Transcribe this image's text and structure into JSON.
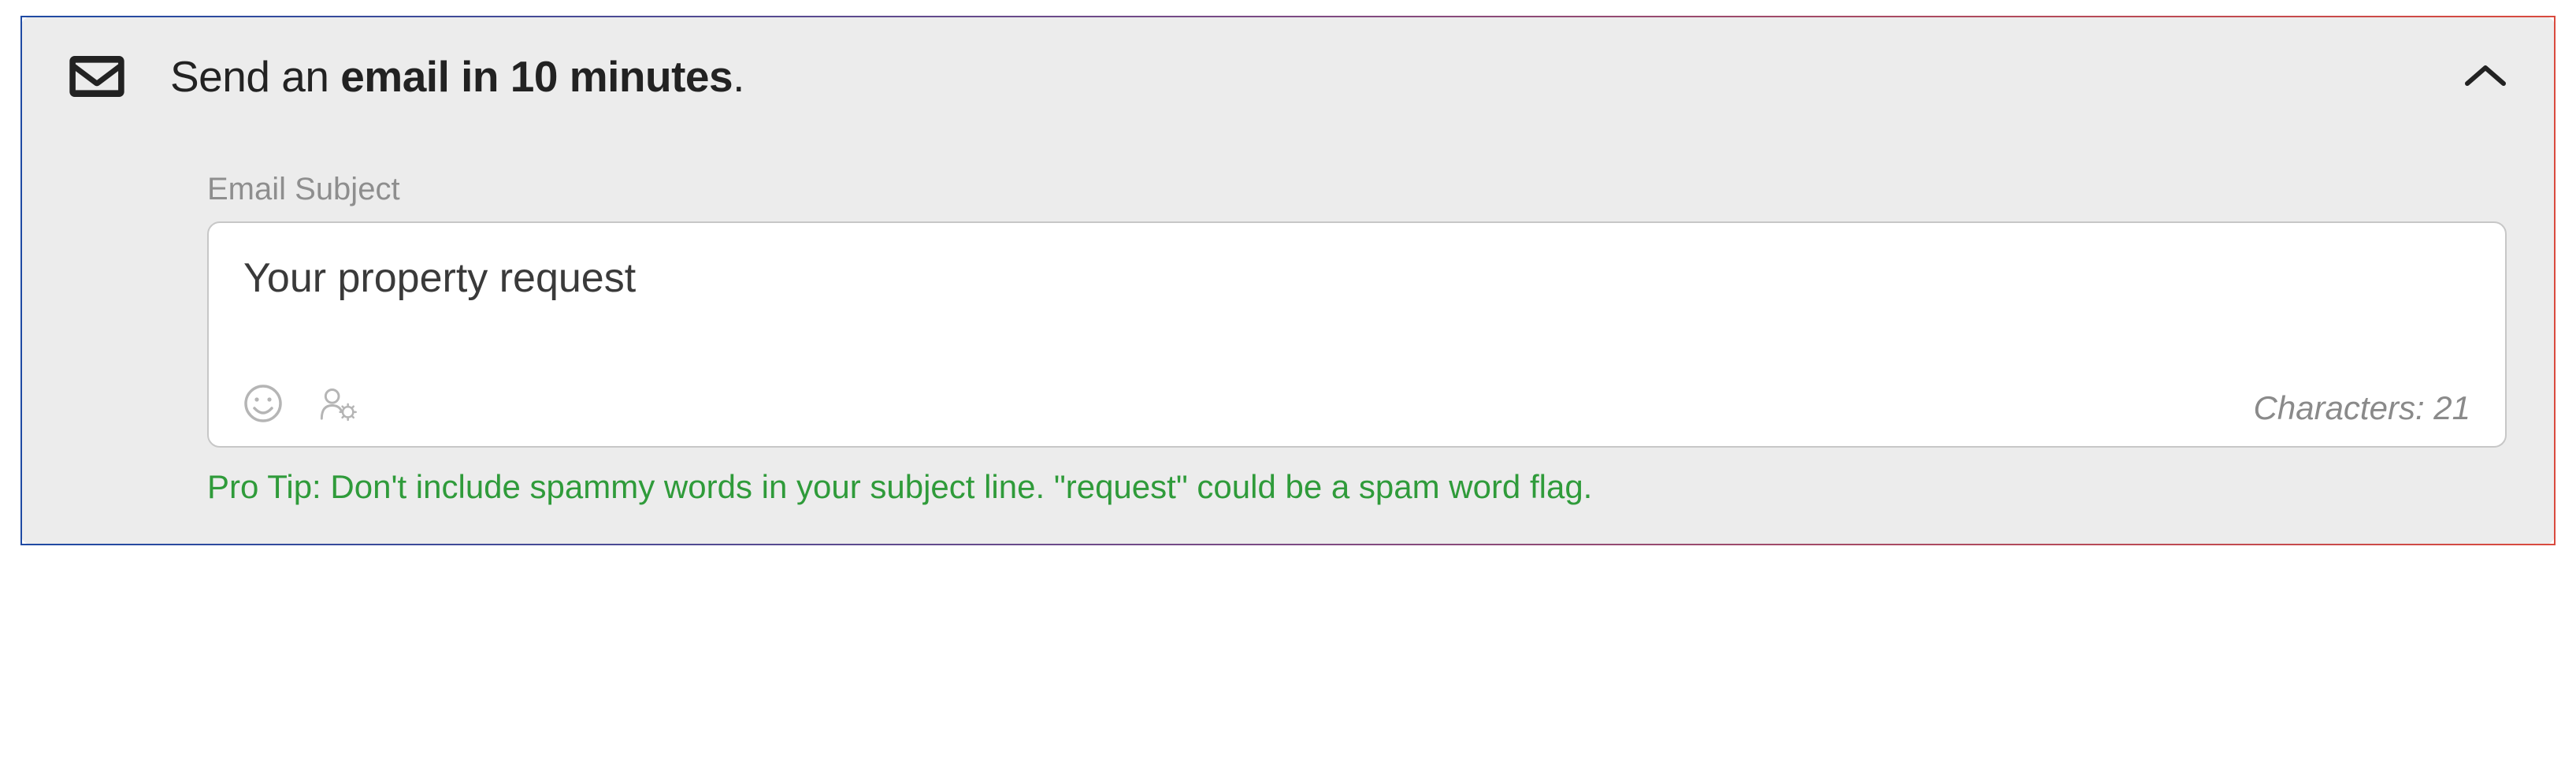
{
  "header": {
    "title_prefix": "Send an ",
    "title_bold": "email in 10 minutes",
    "title_suffix": "."
  },
  "subject_field": {
    "label": "Email Subject",
    "value": "Your property request",
    "char_prefix": "Characters: ",
    "char_count": "21"
  },
  "tip": {
    "text": "Pro Tip: Don't include spammy words in your subject line. \"request\" could be a spam word flag."
  }
}
